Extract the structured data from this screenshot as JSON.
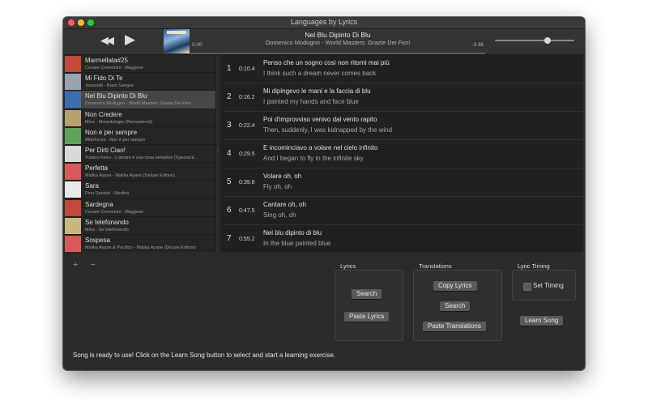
{
  "window": {
    "title": "Languages by Lyrics"
  },
  "player": {
    "song_title": "Nel Blu Dipinto Di Blu",
    "song_subtitle": "Domenico Modugno - World Masters: Grazie Dei Fiori",
    "time_elapsed": "0:00",
    "time_remaining": "-3:36",
    "progress_fraction": 0.0,
    "volume_fraction": 0.66
  },
  "songs": [
    {
      "title": "Marmellata#25",
      "subtitle": "Cesare Cremonini - Maggese",
      "thumb_color": "#c24a3a"
    },
    {
      "title": "Mi Fido Di Te",
      "subtitle": "Jovanotti - Buon Sangue",
      "thumb_color": "#9aa3b0"
    },
    {
      "title": "Nel Blu Dipinto Di Blu",
      "subtitle": "Domenico Modugno - World Masters: Grazie Dei Fiori",
      "thumb_color": "#3d6fb0"
    },
    {
      "title": "Non Credere",
      "subtitle": "Mina - Minantologia (Remastered)",
      "thumb_color": "#b8a070"
    },
    {
      "title": "Non è per sempre",
      "subtitle": "Afterhours - Non è per sempre",
      "thumb_color": "#5fa35a"
    },
    {
      "title": "Per Dirti Ciao!",
      "subtitle": "Tiziano Ferro - L'amore è una cosa semplice (Special E...",
      "thumb_color": "#d8d8d8"
    },
    {
      "title": "Perfetta",
      "subtitle": "Malika Ayane - Malika Ayane (Deluxe Edition)",
      "thumb_color": "#d85a5a"
    },
    {
      "title": "Sara",
      "subtitle": "Pino Daniele - Medina",
      "thumb_color": "#e8e8e8"
    },
    {
      "title": "Sardegna",
      "subtitle": "Cesare Cremonini - Maggese",
      "thumb_color": "#c24a3a"
    },
    {
      "title": "Se telefonando",
      "subtitle": "Mina - Se telefonando",
      "thumb_color": "#c8b880"
    },
    {
      "title": "Sospesa",
      "subtitle": "Malika Ayane & Pacifico - Malika Ayane (Deluxe Edition)",
      "thumb_color": "#d85a5a"
    }
  ],
  "selected_song_index": 2,
  "lyrics": [
    {
      "num": "1",
      "time": "0:10.4",
      "line": "Penso che un sogno così non ritorni mai più",
      "translation": "I think such a dream never comes back"
    },
    {
      "num": "2",
      "time": "0:16.2",
      "line": "Mi dipingevo le mani e la faccia di blu",
      "translation": "I painted my hands and face blue"
    },
    {
      "num": "3",
      "time": "0:22.4",
      "line": "Poi d'improvviso venivo dal vento rapito",
      "translation": "Then, suddenly, I was kidnapped by the wind"
    },
    {
      "num": "4",
      "time": "0:29.5",
      "line": "E incominciavo a volare nel cielo infinito",
      "translation": "And I began to fly in the infinite sky"
    },
    {
      "num": "5",
      "time": "0:39.8",
      "line": "Volare oh, oh",
      "translation": "Fly oh, oh"
    },
    {
      "num": "6",
      "time": "0:47.5",
      "line": "Cantare oh, oh",
      "translation": "Sing oh, oh"
    },
    {
      "num": "7",
      "time": "0:55.2",
      "line": "Nel blu dipinto di blu",
      "translation": "In the blue painted blue"
    }
  ],
  "list_actions": {
    "add": "+",
    "remove": "−"
  },
  "lyrics_group": {
    "label": "Lyrics",
    "search": "Search",
    "paste": "Paste Lyrics"
  },
  "translations_group": {
    "label": "Translations",
    "copy": "Copy Lyrics",
    "search": "Search",
    "paste": "Paste Translations"
  },
  "timing_group": {
    "label": "Lyric Timing",
    "set_timing": "Set Timing",
    "set_timing_checked": false
  },
  "learn_button": "Learn Song",
  "status": "Song is ready to use! Click on the Learn Song button to select and start a learning exercise.",
  "icons": {
    "rewind": "rewind-icon",
    "play": "play-icon"
  }
}
